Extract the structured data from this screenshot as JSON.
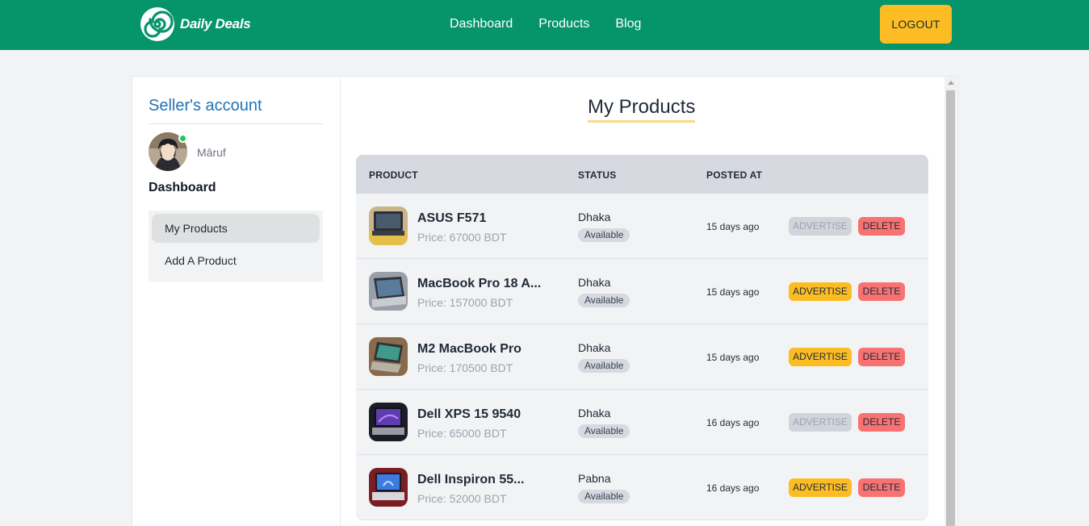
{
  "brand": {
    "name": "Daily Deals"
  },
  "nav": {
    "links": [
      "Dashboard",
      "Products",
      "Blog"
    ],
    "logout_label": "LOGOUT"
  },
  "sidebar": {
    "title": "Seller's account",
    "username": "Māruf",
    "dashboard_heading": "Dashboard",
    "menu": [
      {
        "label": "My Products",
        "active": true
      },
      {
        "label": "Add A Product",
        "active": false
      }
    ]
  },
  "main": {
    "title": "My Products",
    "columns": [
      "PRODUCT",
      "STATUS",
      "POSTED AT"
    ],
    "advertise_label": "ADVERTISE",
    "delete_label": "DELETE",
    "products": [
      {
        "name": "ASUS F571",
        "price": "Price: 67000 BDT",
        "location": "Dhaka",
        "status": "Available",
        "posted": "15 days ago",
        "advertise_enabled": false
      },
      {
        "name": "MacBook Pro 18 A...",
        "price": "Price: 157000 BDT",
        "location": "Dhaka",
        "status": "Available",
        "posted": "15 days ago",
        "advertise_enabled": true
      },
      {
        "name": "M2 MacBook Pro",
        "price": "Price: 170500 BDT",
        "location": "Dhaka",
        "status": "Available",
        "posted": "15 days ago",
        "advertise_enabled": true
      },
      {
        "name": "Dell XPS 15 9540",
        "price": "Price: 65000 BDT",
        "location": "Dhaka",
        "status": "Available",
        "posted": "16 days ago",
        "advertise_enabled": false
      },
      {
        "name": "Dell Inspiron 55...",
        "price": "Price: 52000 BDT",
        "location": "Pabna",
        "status": "Available",
        "posted": "16 days ago",
        "advertise_enabled": true
      }
    ]
  },
  "colors": {
    "nav_bg": "#06946a",
    "accent_yellow": "#fbbd23",
    "delete_red": "#f87272",
    "title_blue": "#2373b8"
  }
}
